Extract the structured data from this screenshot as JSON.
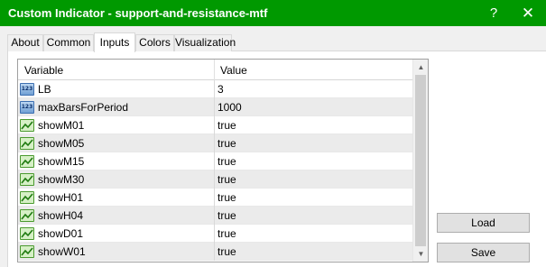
{
  "window": {
    "title": "Custom Indicator - support-and-resistance-mtf",
    "help_glyph": "?",
    "close_glyph": "✕",
    "title_bar_color": "#009900"
  },
  "tabs": [
    {
      "label": "About",
      "active": false
    },
    {
      "label": "Common",
      "active": false
    },
    {
      "label": "Inputs",
      "active": true
    },
    {
      "label": "Colors",
      "active": false
    },
    {
      "label": "Visualization",
      "active": false
    }
  ],
  "grid": {
    "columns": {
      "variable": "Variable",
      "value": "Value"
    },
    "rows": [
      {
        "name": "LB",
        "value": "3",
        "icon": "numeric-icon",
        "icon_text": "123"
      },
      {
        "name": "maxBarsForPeriod",
        "value": "1000",
        "icon": "numeric-icon",
        "icon_text": "123"
      },
      {
        "name": "showM01",
        "value": "true",
        "icon": "boolean-icon"
      },
      {
        "name": "showM05",
        "value": "true",
        "icon": "boolean-icon"
      },
      {
        "name": "showM15",
        "value": "true",
        "icon": "boolean-icon"
      },
      {
        "name": "showM30",
        "value": "true",
        "icon": "boolean-icon"
      },
      {
        "name": "showH01",
        "value": "true",
        "icon": "boolean-icon"
      },
      {
        "name": "showH04",
        "value": "true",
        "icon": "boolean-icon"
      },
      {
        "name": "showD01",
        "value": "true",
        "icon": "boolean-icon"
      },
      {
        "name": "showW01",
        "value": "true",
        "icon": "boolean-icon"
      }
    ]
  },
  "buttons": {
    "load": "Load",
    "save": "Save"
  }
}
